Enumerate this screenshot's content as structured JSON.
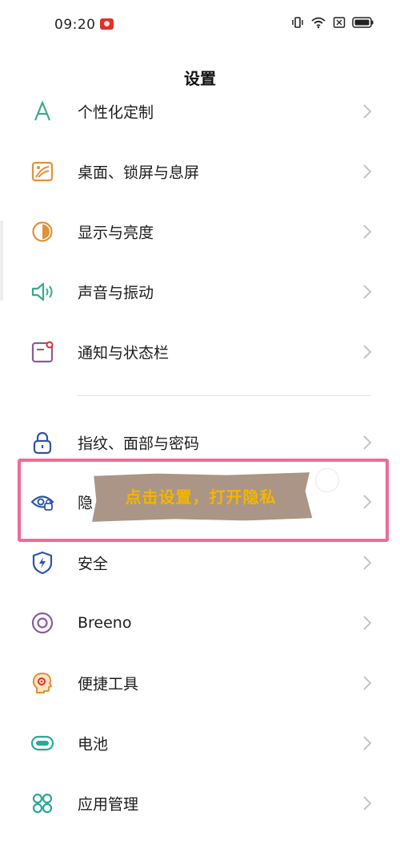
{
  "status_bar": {
    "time": "09:20",
    "icons": [
      "screen-record-icon",
      "vibrate-icon",
      "wifi-icon",
      "nfc-icon",
      "battery-icon"
    ]
  },
  "header": {
    "title": "设置"
  },
  "settings_items": [
    {
      "label": "个性化定制",
      "icon": "personalize-icon"
    },
    {
      "label": "桌面、锁屏与息屏",
      "icon": "wallpaper-icon"
    },
    {
      "label": "显示与亮度",
      "icon": "display-icon"
    },
    {
      "label": "声音与振动",
      "icon": "sound-icon"
    },
    {
      "label": "通知与状态栏",
      "icon": "notification-icon"
    },
    {
      "label": "指纹、面部与密码",
      "icon": "lock-icon"
    },
    {
      "label": "隐",
      "icon": "privacy-icon"
    },
    {
      "label": "安全",
      "icon": "security-icon"
    },
    {
      "label": "Breeno",
      "icon": "breeno-icon"
    },
    {
      "label": "便捷工具",
      "icon": "tools-icon"
    },
    {
      "label": "电池",
      "icon": "battery-setting-icon"
    },
    {
      "label": "应用管理",
      "icon": "apps-icon"
    }
  ],
  "annotation": {
    "text": "点击设置，打开隐私",
    "highlight_color": "#ef6b95",
    "text_color": "#f2b600"
  },
  "colors": {
    "icon_green": "#3aaa8b",
    "icon_orange": "#e0913a",
    "icon_blue": "#2c55a8",
    "icon_purple": "#8b5a9e",
    "icon_teal": "#2aa89a",
    "chevron": "#c4c4c4"
  }
}
